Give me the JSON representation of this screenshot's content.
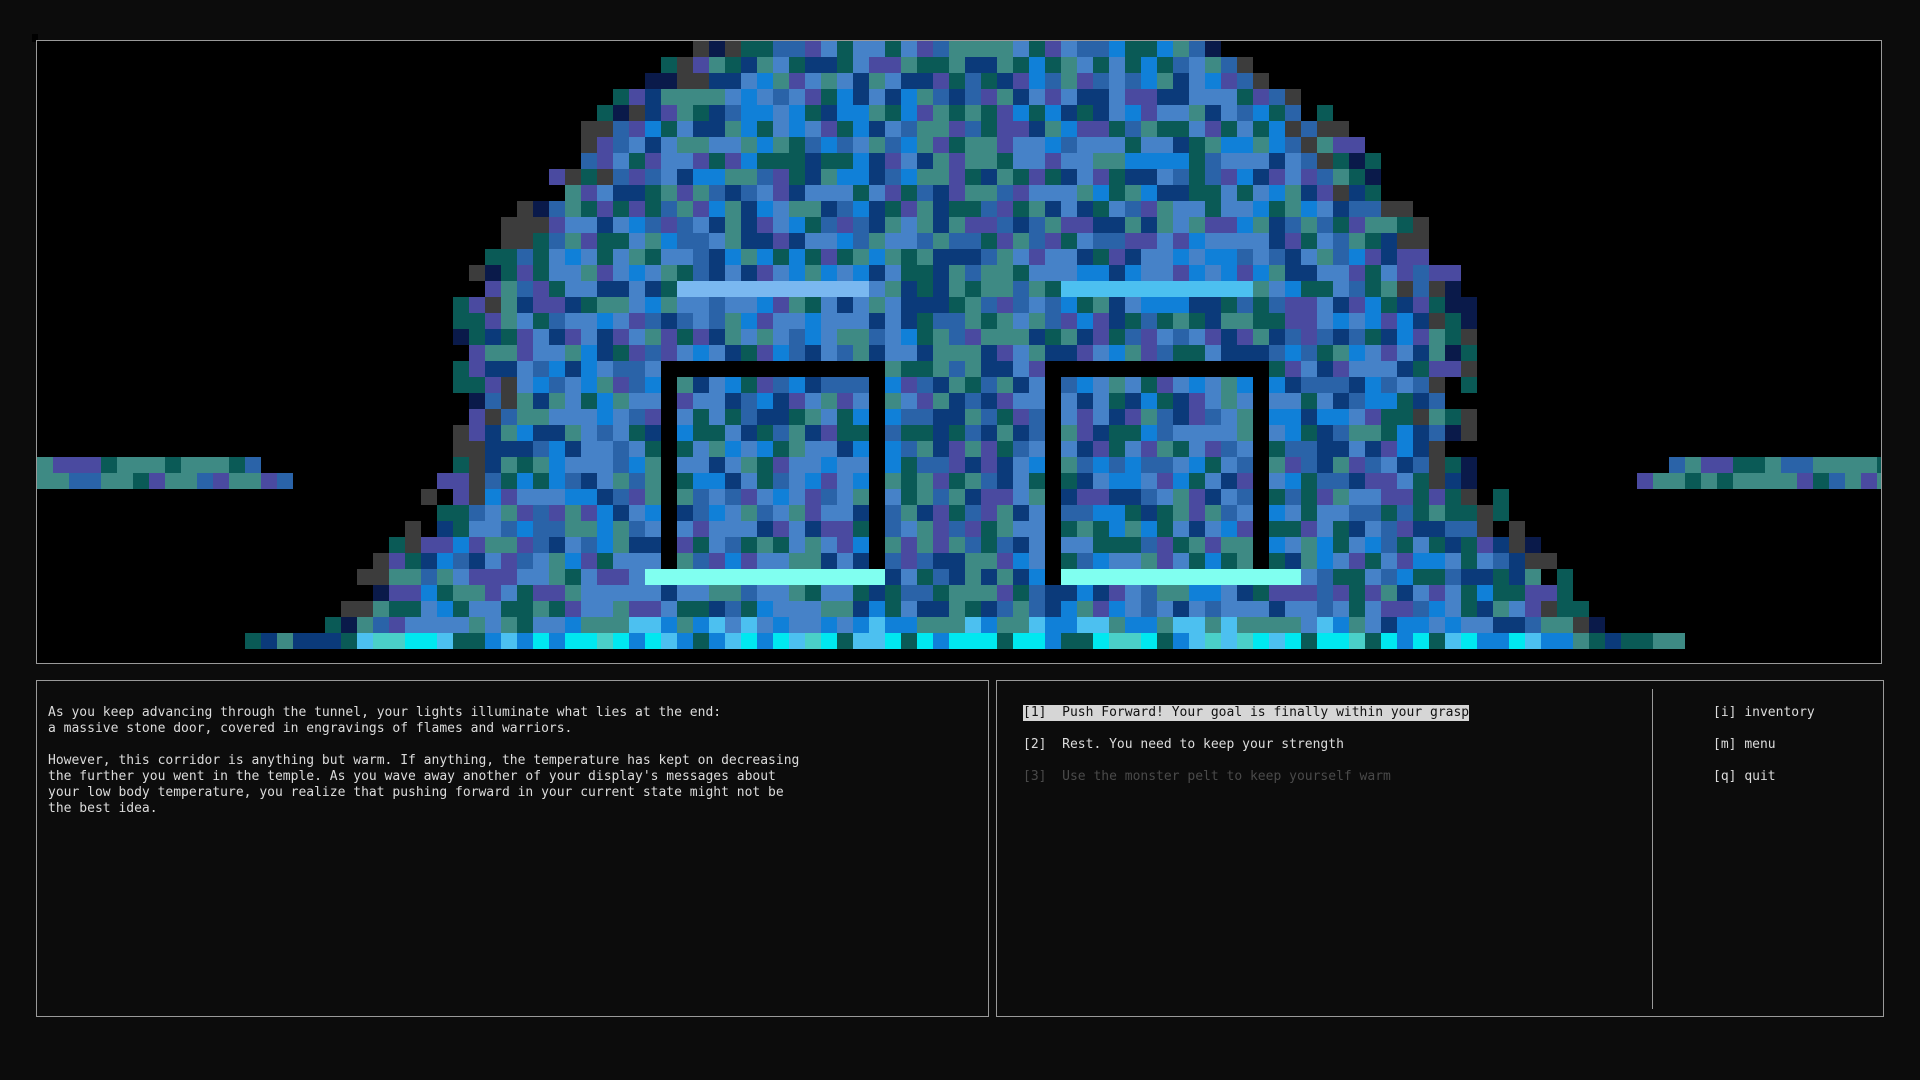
{
  "scene": {
    "description_icon": "stone-door-pixel-art",
    "palette": {
      "black": "#000000",
      "gray": "#3c3c3c",
      "teal": "#3e8a84",
      "dark_teal": "#0a5a56",
      "deep_teal": "#064440",
      "blue": "#4682c8",
      "mid_blue": "#2a63a8",
      "navy": "#0b3a7a",
      "deep_navy": "#0a1a4a",
      "purple": "#4a4aa0",
      "light_blue": "#7ab8f0",
      "sky": "#4cc0f0",
      "cyan": "#00e8f0",
      "aqua": "#4ad0c8",
      "pale_cyan": "#80fff0",
      "bright_blue": "#1080d8"
    }
  },
  "story": {
    "paragraph1": "As you keep advancing through the tunnel, your lights illuminate what lies at the end:\na massive stone door, covered in engravings of flames and warriors.",
    "paragraph2": "However, this corridor is anything but warm. If anything, the temperature has kept on decreasing\nthe further you went in the temple. As you wave away another of your display's messages about\nyour low body temperature, you realize that pushing forward in your current state might not be\nthe best idea."
  },
  "choices": [
    {
      "key": "[1]",
      "label": "Push Forward! Your goal is finally within your grasp",
      "state": "selected"
    },
    {
      "key": "[2]",
      "label": "Rest. You need to keep your strength",
      "state": "enabled"
    },
    {
      "key": "[3]",
      "label": "Use the monster pelt to keep yourself warm",
      "state": "disabled"
    }
  ],
  "hotkeys": [
    {
      "key": "[i]",
      "label": "inventory"
    },
    {
      "key": "[m]",
      "label": "menu"
    },
    {
      "key": "[q]",
      "label": "quit"
    }
  ]
}
